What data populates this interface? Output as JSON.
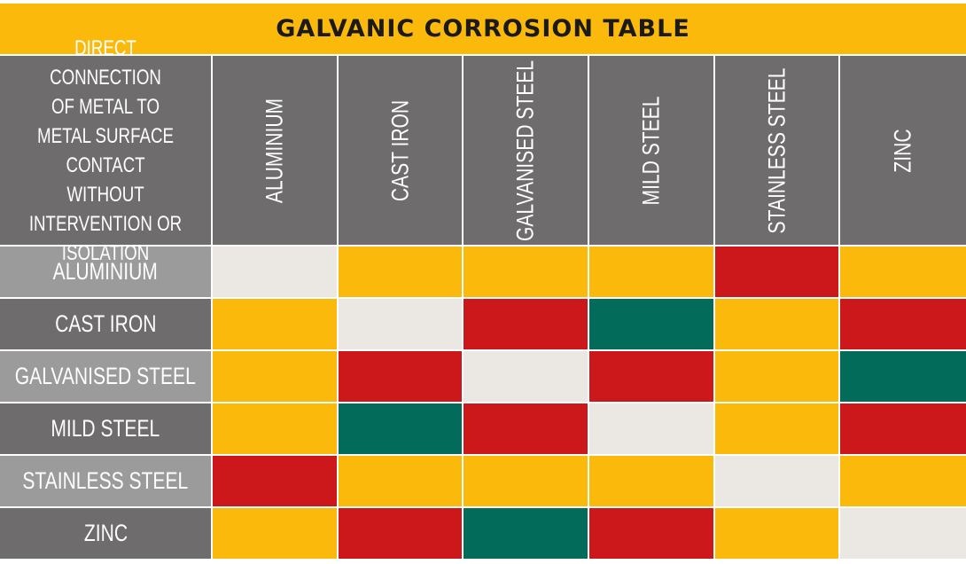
{
  "title": "GALVANIC CORROSION TABLE",
  "colors": {
    "title_band": "#fbb90b",
    "header_bg": "#6e6c6d",
    "row_light": "#9c9b9b",
    "row_dark": "#6e6c6d",
    "same": "#ebe8e3",
    "amber": "#fbb90b",
    "red": "#cc181a",
    "green": "#036b5a"
  },
  "chart_data": {
    "type": "heatmap",
    "title": "GALVANIC CORROSION TABLE",
    "corner_label": "DIRECT CONNECTION\nOF METAL TO\nMETAL SURFACE\nCONTACT WITHOUT\nINTERVENTION OR\nISOLATION",
    "columns": [
      "ALUMINIUM",
      "CAST IRON",
      "GALVANISED STEEL",
      "MILD STEEL",
      "STAINLESS STEEL",
      "ZINC"
    ],
    "rows": [
      "ALUMINIUM",
      "CAST IRON",
      "GALVANISED STEEL",
      "MILD STEEL",
      "STAINLESS STEEL",
      "ZINC"
    ],
    "legend_categories": [
      "same",
      "amber",
      "red",
      "green"
    ],
    "matrix": [
      [
        "same",
        "amber",
        "amber",
        "amber",
        "red",
        "amber"
      ],
      [
        "amber",
        "same",
        "red",
        "green",
        "amber",
        "red"
      ],
      [
        "amber",
        "red",
        "same",
        "red",
        "amber",
        "green"
      ],
      [
        "amber",
        "green",
        "red",
        "same",
        "amber",
        "red"
      ],
      [
        "red",
        "amber",
        "amber",
        "amber",
        "same",
        "amber"
      ],
      [
        "amber",
        "red",
        "green",
        "red",
        "amber",
        "same"
      ]
    ]
  }
}
